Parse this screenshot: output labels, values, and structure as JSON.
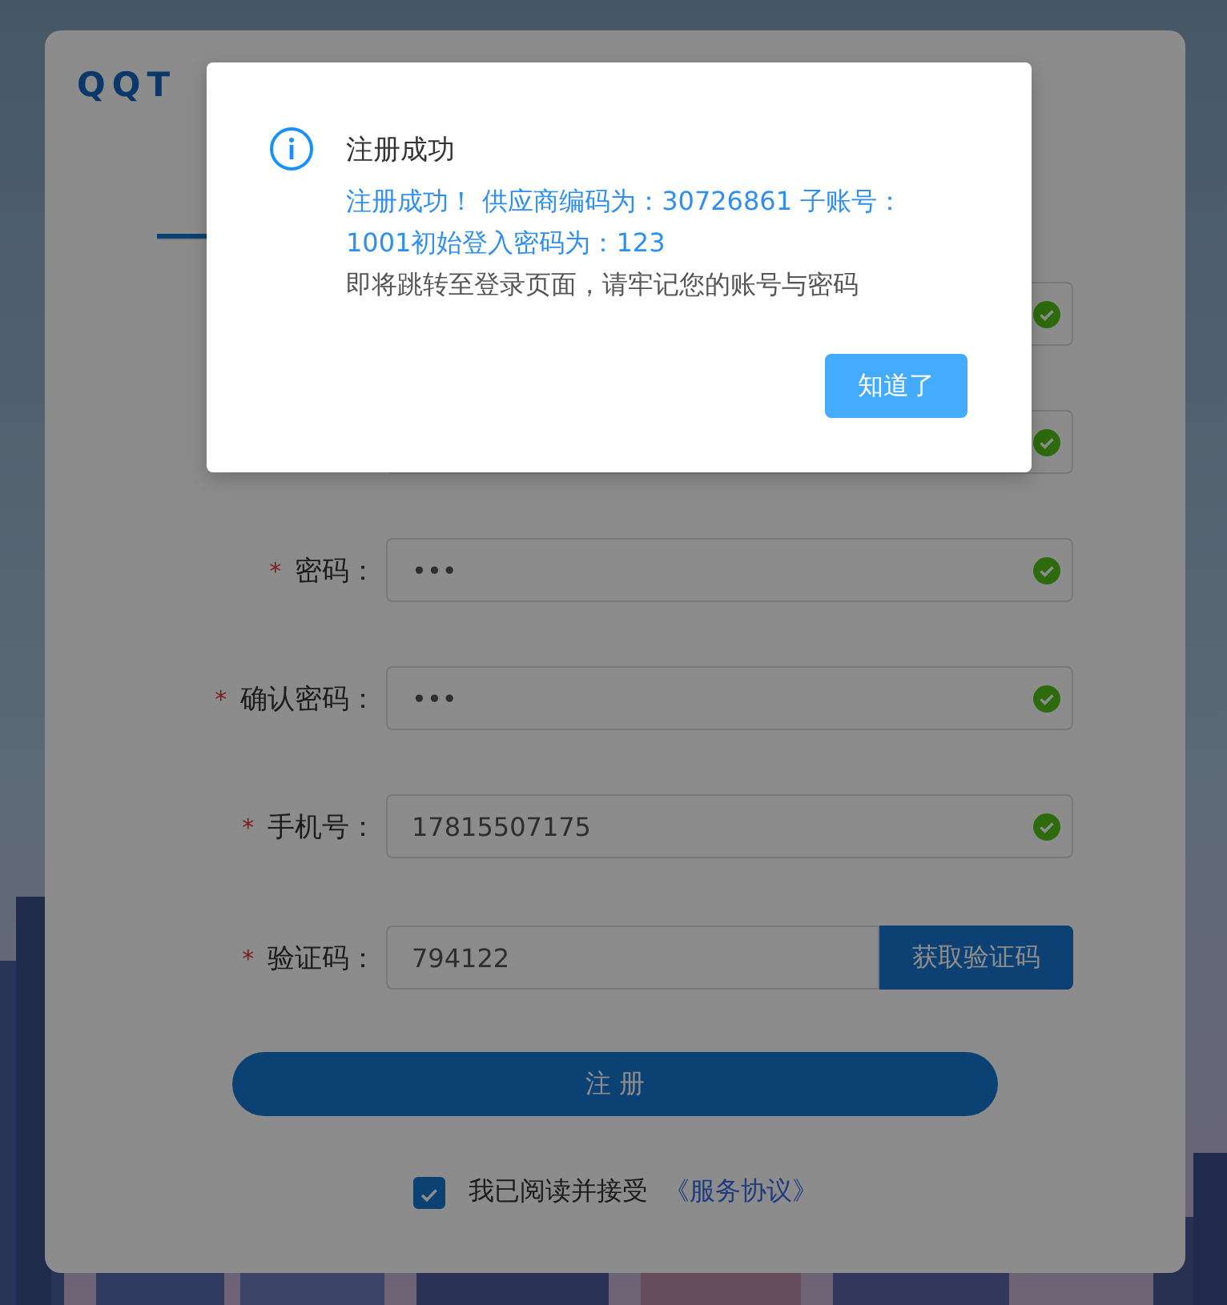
{
  "brand": "QQT",
  "tabs": [
    {
      "selected": true
    }
  ],
  "fields": [
    {
      "kind": "input",
      "valid": true
    },
    {
      "kind": "input",
      "valid": true
    },
    {
      "kind": "input",
      "mark": "*",
      "label": "密码：",
      "value": "•••",
      "valid": true
    },
    {
      "kind": "input",
      "mark": "*",
      "label": "确认密码：",
      "value": "•••",
      "valid": true
    },
    {
      "kind": "input",
      "mark": "*",
      "label": "手机号：",
      "value": "17815507175",
      "valid": true
    },
    {
      "kind": "code",
      "mark": "*",
      "label": "验证码：",
      "value": "794122",
      "valid": false,
      "button": "获取验证码"
    }
  ],
  "register_button": "注 册",
  "agreement": {
    "checked": true,
    "text": "我已阅读并接受",
    "link": "《服务协议》"
  },
  "dialog": {
    "title": "注册成功",
    "message": "注册成功！ 供应商编码为：30726861 子账号：1001初始登入密码为：123",
    "note": "即将跳转至登录页面，请牢记您的账号与密码",
    "button": "知道了"
  }
}
